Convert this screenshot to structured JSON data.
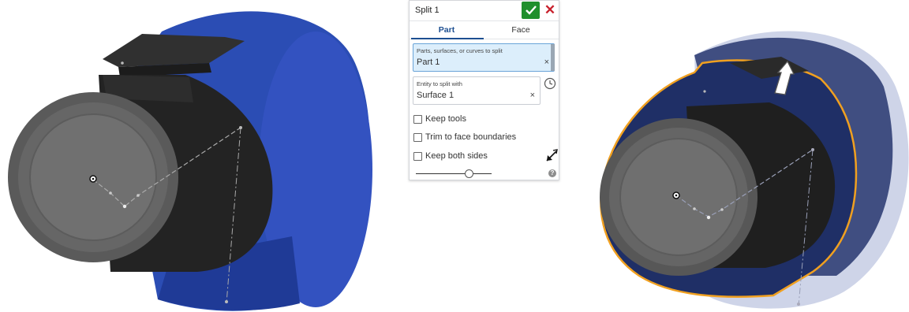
{
  "dialog": {
    "title": "Split 1",
    "tabs": [
      {
        "label": "Part",
        "active": true
      },
      {
        "label": "Face",
        "active": false
      }
    ],
    "fields": [
      {
        "label": "Parts, surfaces, or curves to split",
        "value": "Part 1",
        "clear": "×"
      },
      {
        "label": "Entity to split with",
        "value": "Surface 1",
        "clear": "×"
      }
    ],
    "checkboxes": [
      {
        "label": "Keep tools",
        "checked": false
      },
      {
        "label": "Trim to face boundaries",
        "checked": false
      },
      {
        "label": "Keep both sides",
        "checked": false
      }
    ],
    "cancel_glyph": "✕",
    "help_glyph": "?",
    "slider_value": 0.65
  },
  "colors": {
    "accent": "#1d4f91",
    "ok": "#1f8f2c",
    "cancel": "#c8202c",
    "part_blue": "#2b4db4",
    "selection_orange": "#f0a020"
  },
  "icons": [
    "checkmark-icon",
    "close-icon",
    "history-icon",
    "flip-direction-icon",
    "help-icon"
  ]
}
